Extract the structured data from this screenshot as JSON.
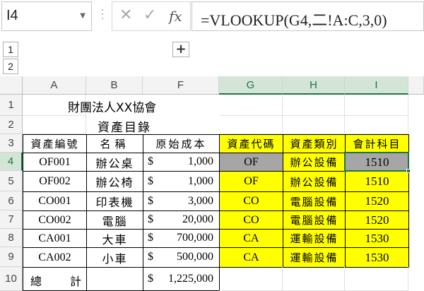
{
  "formula_bar": {
    "name_box": "I4",
    "formula": "=VLOOKUP(G4,二!A:C,3,0)",
    "cancel_glyph": "✕",
    "enter_glyph": "✓",
    "fx_label": "fx"
  },
  "outline": {
    "levels": [
      "1",
      "2"
    ],
    "expand_glyph": "+"
  },
  "columns": [
    "A",
    "B",
    "F",
    "G",
    "H",
    "I"
  ],
  "rows": [
    "1",
    "2",
    "3",
    "4",
    "5",
    "6",
    "7",
    "8",
    "9",
    "10"
  ],
  "title": "財團法人XX協會",
  "subtitle": "資產目錄",
  "headers": {
    "a": "資產編號",
    "b": "名稱",
    "f": "原始成本",
    "g": "資產代碼",
    "h": "資產類別",
    "i": "會計科目"
  },
  "data_rows": [
    {
      "code": "OF001",
      "name": "辦公桌",
      "currency": "$",
      "cost": "1,000",
      "asset_code": "OF",
      "category": "辦公設備",
      "account": "1510"
    },
    {
      "code": "OF002",
      "name": "辦公椅",
      "currency": "$",
      "cost": "1,000",
      "asset_code": "OF",
      "category": "辦公設備",
      "account": "1510"
    },
    {
      "code": "CO001",
      "name": "印表機",
      "currency": "$",
      "cost": "3,000",
      "asset_code": "CO",
      "category": "電腦設備",
      "account": "1520"
    },
    {
      "code": "CO002",
      "name": "電腦",
      "currency": "$",
      "cost": "20,000",
      "asset_code": "CO",
      "category": "電腦設備",
      "account": "1520"
    },
    {
      "code": "CA001",
      "name": "大車",
      "currency": "$",
      "cost": "700,000",
      "asset_code": "CA",
      "category": "運輸設備",
      "account": "1530"
    },
    {
      "code": "CA002",
      "name": "小車",
      "currency": "$",
      "cost": "500,000",
      "asset_code": "CA",
      "category": "運輸設備",
      "account": "1530"
    }
  ],
  "total": {
    "label_1": "總",
    "label_2": "計",
    "currency": "$",
    "value": "1,225,000"
  },
  "colors": {
    "highlight": "#ffff00",
    "selected_gray": "#a6a6a6",
    "excel_green": "#217346"
  }
}
